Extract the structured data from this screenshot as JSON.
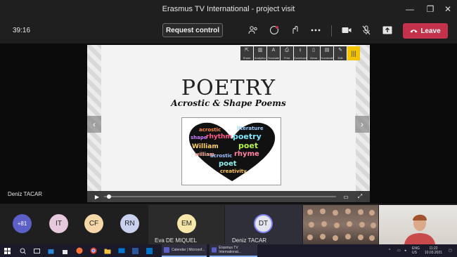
{
  "window": {
    "title": "Erasmus TV International - project visit",
    "minimize": "—",
    "maximize": "❐",
    "close": "✕"
  },
  "toolbar": {
    "timer": "39:16",
    "request_control": "Request control",
    "leave": "Leave",
    "icons": [
      "people-icon",
      "chat-icon",
      "reactions-icon",
      "more-icon",
      "camera-icon",
      "mic-off-icon",
      "share-icon"
    ]
  },
  "slide": {
    "title": "POETRY",
    "subtitle": "Acrostic & Shape Poems",
    "heart_words": [
      "acrostic",
      "literature",
      "shape",
      "rhythm",
      "poetry",
      "William",
      "poet",
      "rhyme",
      "acrostic",
      "william",
      "poet",
      "creativity"
    ],
    "tools": [
      "Share",
      "Analytics",
      "Translate",
      "Print",
      "Download",
      "Views",
      "Thumbnails",
      "Edit"
    ]
  },
  "stage": {
    "presenter_name": "Deniz TACAR"
  },
  "participants": {
    "more_count": "+81",
    "avatars": [
      "IT",
      "CF",
      "RN"
    ],
    "tiles": [
      {
        "initials": "EM",
        "name": "Eva DE MIQUEL"
      },
      {
        "initials": "DT",
        "name": "Deniz TACAR"
      }
    ]
  },
  "taskbar": {
    "apps": [
      {
        "label": "Calendar | Microsof..."
      },
      {
        "label": "Erasmus TV International..."
      }
    ],
    "lang": "ENG\nUS",
    "time": "11:22",
    "date": "10.03.2021"
  },
  "colors": {
    "leave": "#c4314b",
    "accent": "#5b5fc7",
    "background": "#1f1f1f"
  }
}
